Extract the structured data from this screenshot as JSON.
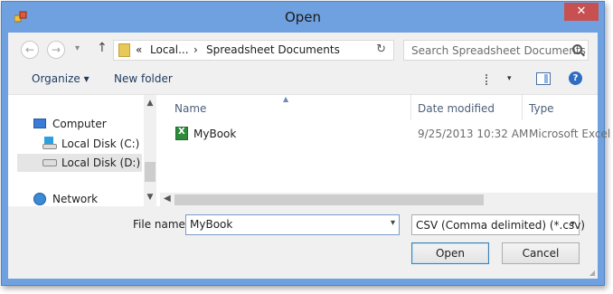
{
  "window": {
    "title": "Open",
    "close_glyph": "✕"
  },
  "nav": {
    "back_glyph": "←",
    "forward_glyph": "→",
    "recent_glyph": "▾",
    "up_glyph": "↑"
  },
  "address": {
    "crumbs": [
      "«",
      "Local...",
      "›",
      "Spreadsheet Documents"
    ],
    "refresh_glyph": "↻"
  },
  "search": {
    "placeholder": "Search Spreadsheet Documents",
    "icon": "search-icon"
  },
  "toolbar": {
    "organize_label": "Organize ▾",
    "new_folder_label": "New folder",
    "view_drop_glyph": "▾",
    "help_glyph": "?"
  },
  "sidebar": {
    "items": [
      {
        "label": "Computer",
        "icon": "computer-icon"
      },
      {
        "label": "Local Disk (C:)",
        "icon": "drive-windows-icon"
      },
      {
        "label": "Local Disk (D:)",
        "icon": "drive-icon",
        "selected": true
      },
      {
        "label": "Network",
        "icon": "network-icon"
      }
    ],
    "scroll_up_glyph": "▲",
    "scroll_down_glyph": "▼"
  },
  "file_list": {
    "columns": [
      "Name",
      "Date modified",
      "Type"
    ],
    "sort_glyph": "▲",
    "rows": [
      {
        "name": "MyBook",
        "date_modified": "9/25/2013 10:32 AM",
        "type": "Microsoft Excel",
        "icon": "excel-file-icon"
      }
    ],
    "scroll_left_glyph": "◀"
  },
  "footer": {
    "file_name_label": "File name:",
    "file_name_value": "MyBook",
    "file_type_value": "CSV (Comma delimited) (*.csv)",
    "dropdown_glyph": "▾",
    "open_label": "Open",
    "cancel_label": "Cancel"
  },
  "colors": {
    "title_bar": "#6fa1e0",
    "close_button": "#c75050",
    "client_bg": "#f0f0f0",
    "selection": "#e5e5e5"
  }
}
